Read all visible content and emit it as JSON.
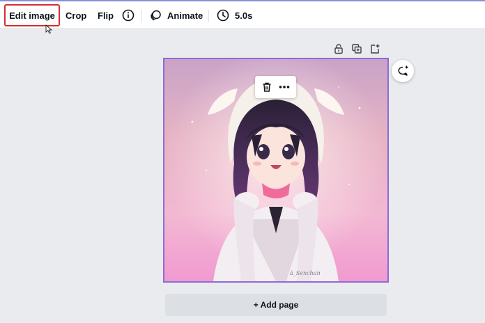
{
  "toolbar": {
    "edit_image_label": "Edit image",
    "crop_label": "Crop",
    "flip_label": "Flip",
    "animate_label": "Animate",
    "duration_label": "5.0s",
    "highlight_color": "#d32f2f"
  },
  "canvas": {
    "selection_color": "#8e6ad8",
    "artwork_signature": "à_Senchan"
  },
  "add_page_label": "+ Add page",
  "icons": {
    "info": "info-icon",
    "animate": "animate-icon",
    "timer": "timer-icon",
    "lock": "lock-icon",
    "duplicate": "duplicate-icon",
    "add_page": "add-page-icon",
    "trash": "trash-icon",
    "more": "more-icon",
    "comment": "comment-icon"
  }
}
